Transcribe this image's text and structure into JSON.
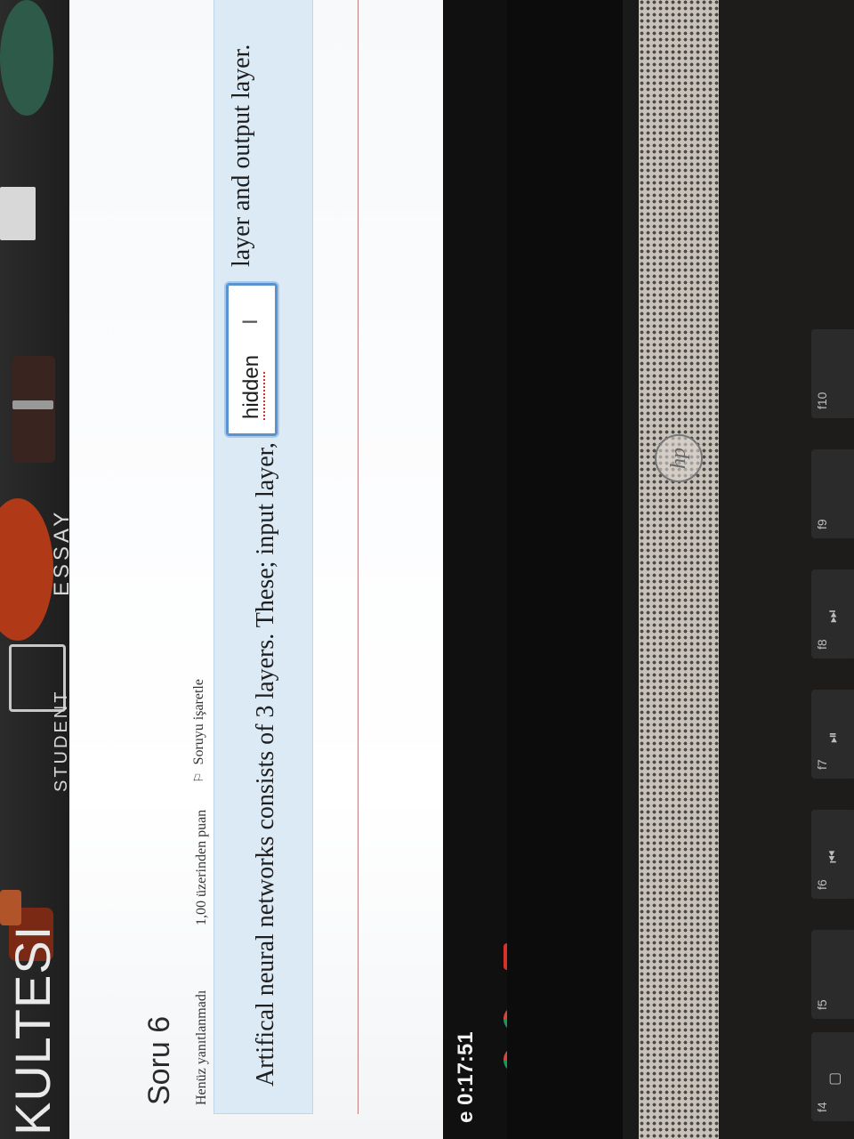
{
  "banner": {
    "title": "KULTESI",
    "student_label": "STUDENT",
    "essay_label": "ESSAY"
  },
  "question": {
    "title": "Soru 6",
    "status": "Henüz yanıtlanmadı",
    "points": "1,00 üzerinden puan",
    "flag_label": "Soruyu işaretle",
    "text_before": "Artifical neural networks consists of 3 layers. These; input layer,",
    "answer_value": "hidden",
    "text_after": "layer and output layer."
  },
  "taskbar": {
    "timer": "e 0:17:51"
  },
  "laptop": {
    "logo": "hp",
    "keys": [
      {
        "label": "f4"
      },
      {
        "label": "f5"
      },
      {
        "label": "f6",
        "glyph": "⏮"
      },
      {
        "label": "f7",
        "glyph": "⏯"
      },
      {
        "label": "f8",
        "glyph": "⏭"
      },
      {
        "label": "f9"
      },
      {
        "label": "f10"
      }
    ]
  },
  "colors": {
    "question_box": "#dbeaf5",
    "answer_border": "#5b93cf",
    "banner_bg": "#1e1e1e"
  }
}
